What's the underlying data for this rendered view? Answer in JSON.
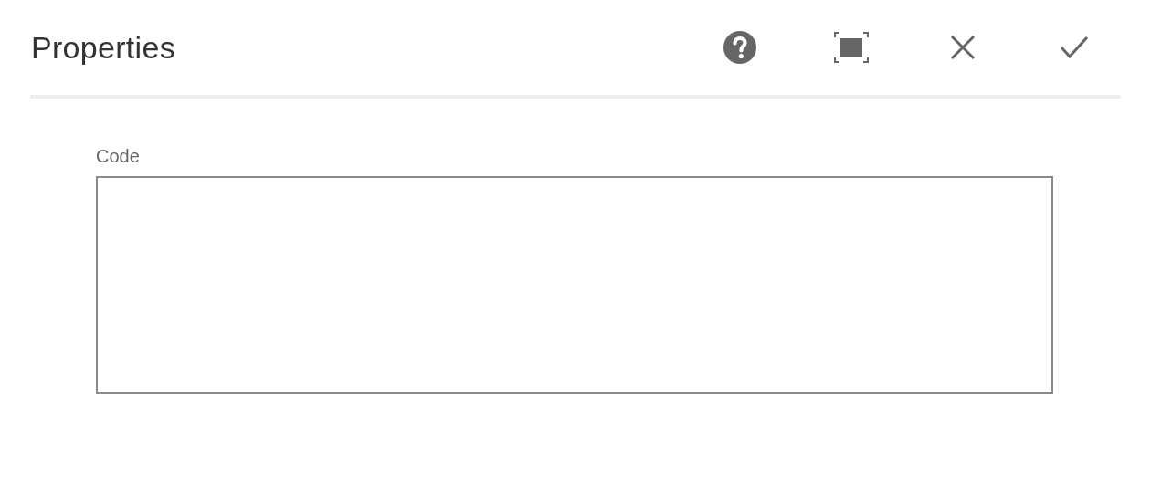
{
  "dialog": {
    "title": "Properties"
  },
  "field": {
    "label": "Code"
  }
}
